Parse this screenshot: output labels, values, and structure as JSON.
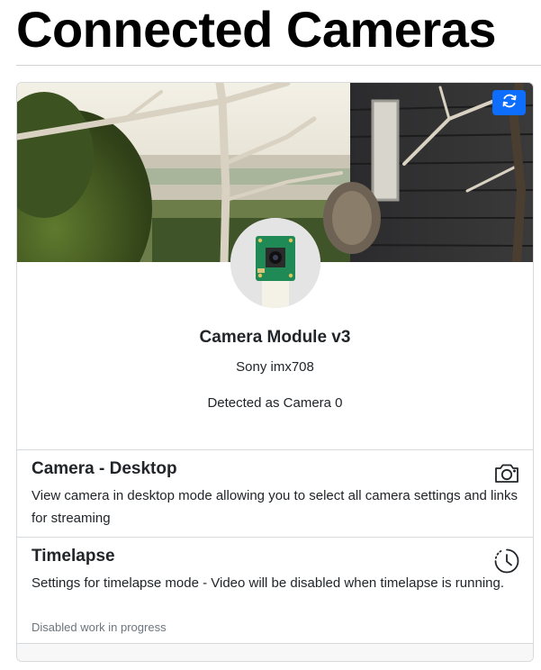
{
  "page": {
    "title": "Connected Cameras"
  },
  "camera": {
    "name": "Camera Module v3",
    "sensor": "Sony imx708",
    "detected": "Detected as Camera 0"
  },
  "items": [
    {
      "title": "Camera - Desktop",
      "description": "View camera in desktop mode allowing you to select all camera settings and links for streaming",
      "icon": "camera-icon"
    },
    {
      "title": "Timelapse",
      "description": "Settings for timelapse mode - Video will be disabled when timelapse is running.",
      "note": "Disabled work in progress",
      "icon": "clock-history-icon"
    }
  ],
  "colors": {
    "accent": "#0d6efd",
    "muted": "#6c757d",
    "border": "#d7dadd"
  }
}
